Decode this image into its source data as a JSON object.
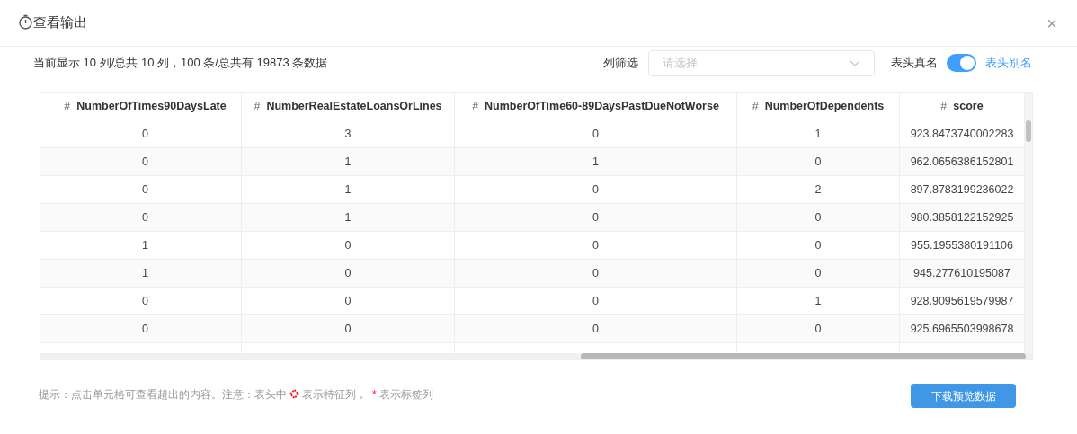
{
  "dialog": {
    "title": "查看输出",
    "close": "×"
  },
  "summary": "当前显示 10 列/总共 10 列，100 条/总共有 19873 条数据",
  "filter": {
    "label": "列筛选",
    "placeholder": "请选择"
  },
  "header_toggle": {
    "off_label": "表头真名",
    "on": true,
    "on_label": "表头别名"
  },
  "table": {
    "columns": [
      {
        "type_mark": "#",
        "name": "NumberOfTimes90DaysLate"
      },
      {
        "type_mark": "#",
        "name": "NumberRealEstateLoansOrLines"
      },
      {
        "type_mark": "#",
        "name": "NumberOfTime60-89DaysPastDueNotWorse"
      },
      {
        "type_mark": "#",
        "name": "NumberOfDependents"
      },
      {
        "type_mark": "#",
        "name": "score"
      }
    ],
    "rows": [
      [
        "0",
        "3",
        "0",
        "1",
        "923.8473740002283"
      ],
      [
        "0",
        "1",
        "1",
        "0",
        "962.0656386152801"
      ],
      [
        "0",
        "1",
        "0",
        "2",
        "897.8783199236022"
      ],
      [
        "0",
        "1",
        "0",
        "0",
        "980.3858122152925"
      ],
      [
        "1",
        "0",
        "0",
        "0",
        "955.1955380191106"
      ],
      [
        "1",
        "0",
        "0",
        "0",
        "945.277610195087"
      ],
      [
        "0",
        "0",
        "0",
        "1",
        "928.9095619579987"
      ],
      [
        "0",
        "0",
        "0",
        "0",
        "925.6965503998678"
      ]
    ]
  },
  "hint": {
    "prefix": "提示：点击单元格可查看超出的内容。注意：表头中",
    "feature": "表示特征列，",
    "star": "*",
    "label": "表示标签列"
  },
  "download_button": "下载预览数据"
}
